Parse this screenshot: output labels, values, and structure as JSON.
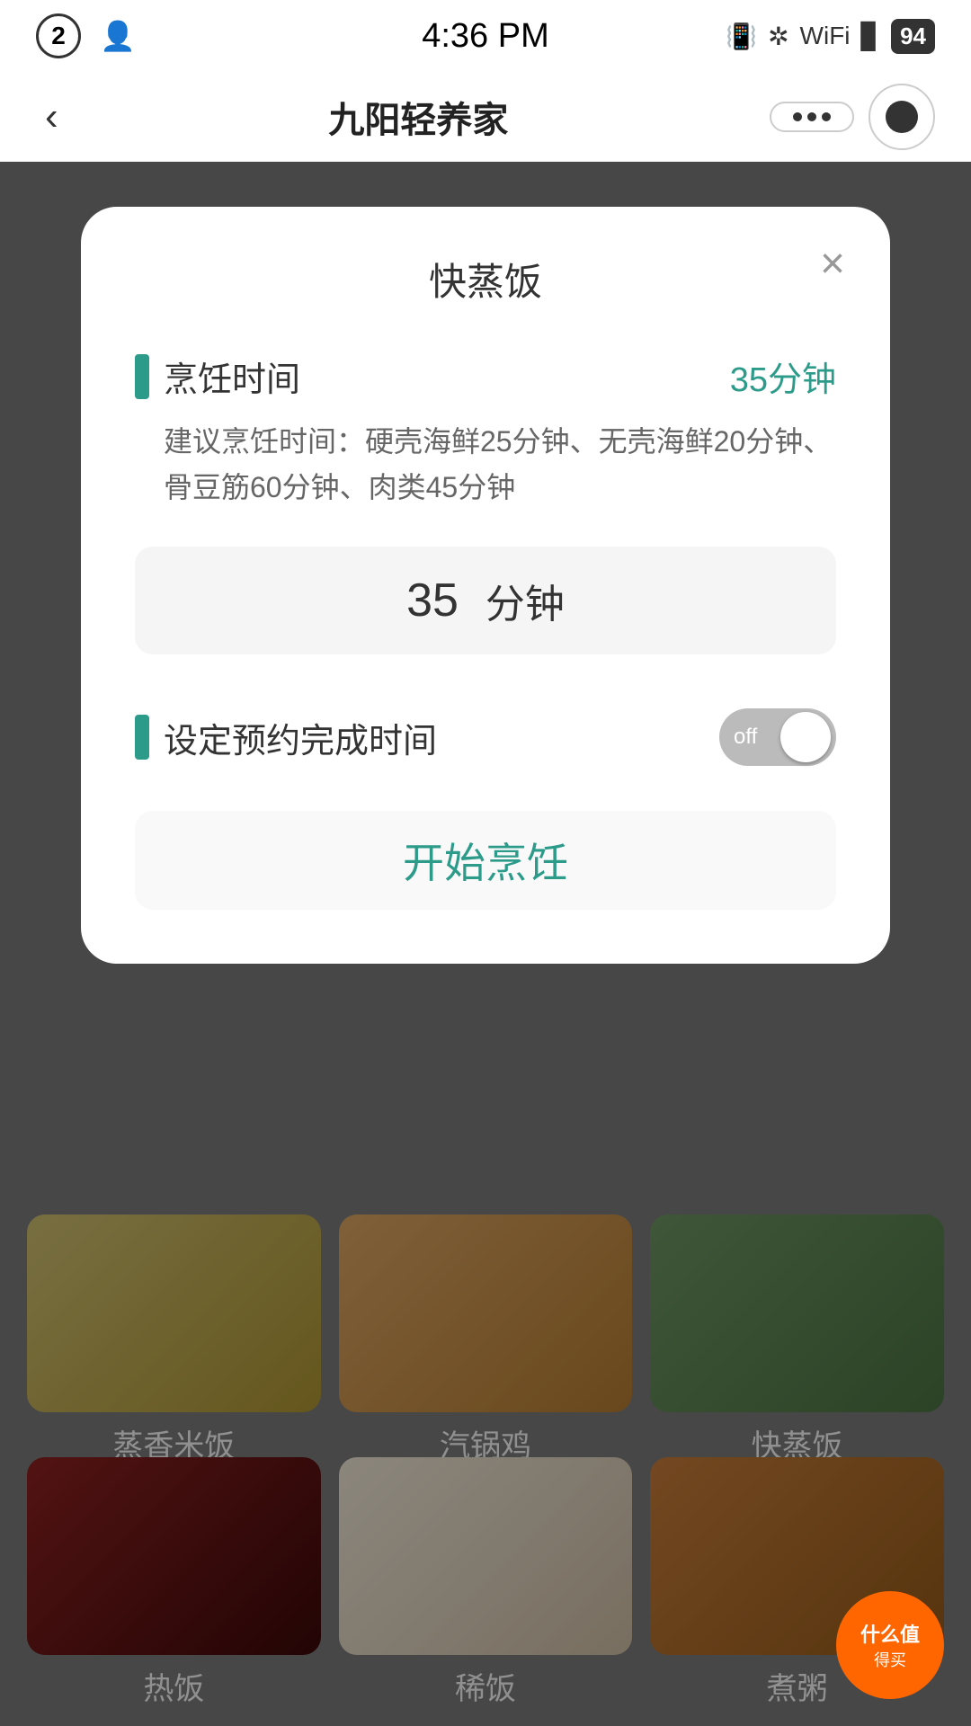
{
  "statusBar": {
    "badge": "2",
    "time": "4:36 PM",
    "batteryPercent": "94"
  },
  "header": {
    "title": "九阳轻养家",
    "backLabel": "‹",
    "menuDots": "•••"
  },
  "modal": {
    "title": "快蒸饭",
    "closeLabel": "×",
    "cookingTimeLabel": "烹饪时间",
    "cookingTimeValue": "35分钟",
    "descText": "建议烹饪时间：硬壳海鲜25分钟、无壳海鲜20分钟、骨豆筋60分钟、肉类45分钟",
    "timeNumber": "35",
    "timeUnit": "分钟",
    "scheduleLabel": "设定预约完成时间",
    "toggleState": "off",
    "startButtonLabel": "开始烹饪"
  },
  "grid": {
    "row1Labels": [
      "蒸香米饭",
      "汽锅鸡",
      "快蒸饭"
    ],
    "row2Labels": [
      "热饭",
      "稀饭",
      "煮粥"
    ]
  },
  "bottomBadge": {
    "top": "什么值得买",
    "show": true
  }
}
